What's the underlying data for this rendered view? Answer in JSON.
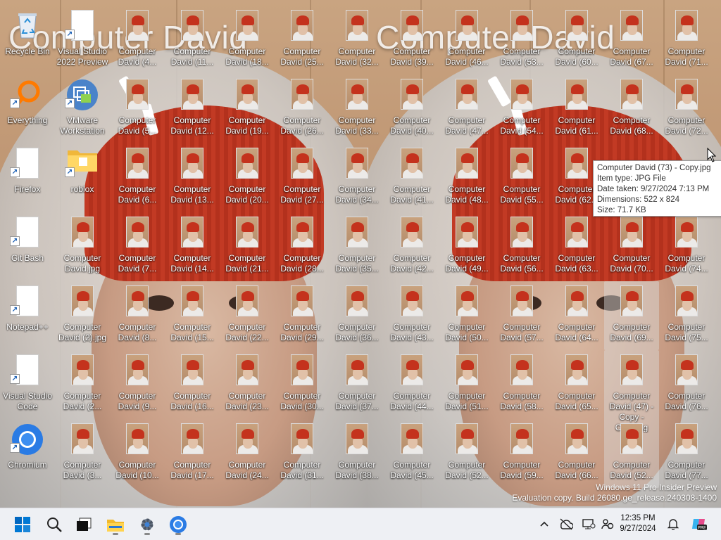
{
  "wallpaper": {
    "left_title": "Computer David",
    "right_title": "Computer David",
    "watermark_line1": "Windows 11 Pro Insider Preview",
    "watermark_line2": "Evaluation copy. Build 26080.ge_release.240308-1400"
  },
  "system_icons": [
    {
      "label": "Recycle Bin",
      "icon": "recycle-bin-icon"
    },
    {
      "label": "Everything",
      "icon": "magnifier-app-icon"
    },
    {
      "label": "Firefox",
      "icon": "blank-file-icon"
    },
    {
      "label": "Git Bash",
      "icon": "blank-file-icon"
    },
    {
      "label": "Notepad++",
      "icon": "blank-file-icon"
    },
    {
      "label": "Visual Studio Code",
      "icon": "blank-file-icon"
    },
    {
      "label": "Chromium",
      "icon": "chromium-icon"
    }
  ],
  "column2_icons": [
    {
      "label": "Visual Studio 2022 Preview",
      "icon": "blank-file-icon"
    },
    {
      "label": "VMware Workstation",
      "icon": "vmware-icon"
    },
    {
      "label": "roblox",
      "icon": "folder-icon"
    },
    {
      "label": "Computer David.jpg",
      "icon": "jpg-thumbnail-icon"
    },
    {
      "label": "Computer David (2).jpg",
      "icon": "jpg-thumbnail-icon"
    },
    {
      "label": "Computer David (2...",
      "icon": "jpg-thumbnail-icon"
    },
    {
      "label": "Computer David (3...",
      "icon": "jpg-thumbnail-icon"
    }
  ],
  "photo_columns": [
    [
      "Computer David (4...",
      "Computer David (5...",
      "Computer David (6...",
      "Computer David (7...",
      "Computer David (8...",
      "Computer David (9...",
      "Computer David (10..."
    ],
    [
      "Computer David (11...",
      "Computer David (12...",
      "Computer David (13...",
      "Computer David (14...",
      "Computer David (15...",
      "Computer David (16...",
      "Computer David (17..."
    ],
    [
      "Computer David (18...",
      "Computer David (19...",
      "Computer David (20...",
      "Computer David (21...",
      "Computer David (22...",
      "Computer David (23...",
      "Computer David (24..."
    ],
    [
      "Computer David (25...",
      "Computer David (26...",
      "Computer David (27...",
      "Computer David (28...",
      "Computer David (29...",
      "Computer David (30...",
      "Computer David (31..."
    ],
    [
      "Computer David (32...",
      "Computer David (33...",
      "Computer David (34...",
      "Computer David (35...",
      "Computer David (36...",
      "Computer David (37...",
      "Computer David (38..."
    ],
    [
      "Computer David (39...",
      "Computer David (40...",
      "Computer David (41...",
      "Computer David (42...",
      "Computer David (43...",
      "Computer David (44...",
      "Computer David (45..."
    ],
    [
      "Computer David (46...",
      "Computer David (47...",
      "Computer David (48...",
      "Computer David (49...",
      "Computer David (50...",
      "Computer David (51...",
      "Computer David (52..."
    ],
    [
      "Computer David (53...",
      "Computer David (54...",
      "Computer David (55...",
      "Computer David (56...",
      "Computer David (57...",
      "Computer David (58...",
      "Computer David (59..."
    ],
    [
      "Computer David (60...",
      "Computer David (61...",
      "Computer David (62...",
      "Computer David (63...",
      "Computer David (64...",
      "Computer David (65...",
      "Computer David (66..."
    ],
    [
      "Computer David (67...",
      "Computer David (68...",
      "",
      "Computer David (70...",
      "Computer David (69...",
      "Computer David (47) - Copy - Copy.jpg",
      "Computer David (52..."
    ],
    [
      "Computer David (71...",
      "Computer David (72...",
      "",
      "Computer David (74...",
      "Computer David (75...",
      "Computer David (76...",
      "Computer David (77..."
    ]
  ],
  "tooltip": {
    "line1": "Computer David (73) - Copy.jpg",
    "line2": "Item type: JPG File",
    "line3": "Date taken: 9/27/2024 7:13 PM",
    "line4": "Dimensions: 522 x 824",
    "line5": "Size: 71.7 KB"
  },
  "taskbar": {
    "apps": [
      "start-icon",
      "search-icon",
      "task-view-icon",
      "file-explorer-icon",
      "settings-icon",
      "chromium-icon"
    ],
    "tray": [
      "show-hidden-icons-chevron",
      "network-offline-icon",
      "display-icon",
      "accessibility-icon"
    ],
    "time": "12:35 PM",
    "date": "9/27/2024",
    "accent": "#0067c0"
  }
}
